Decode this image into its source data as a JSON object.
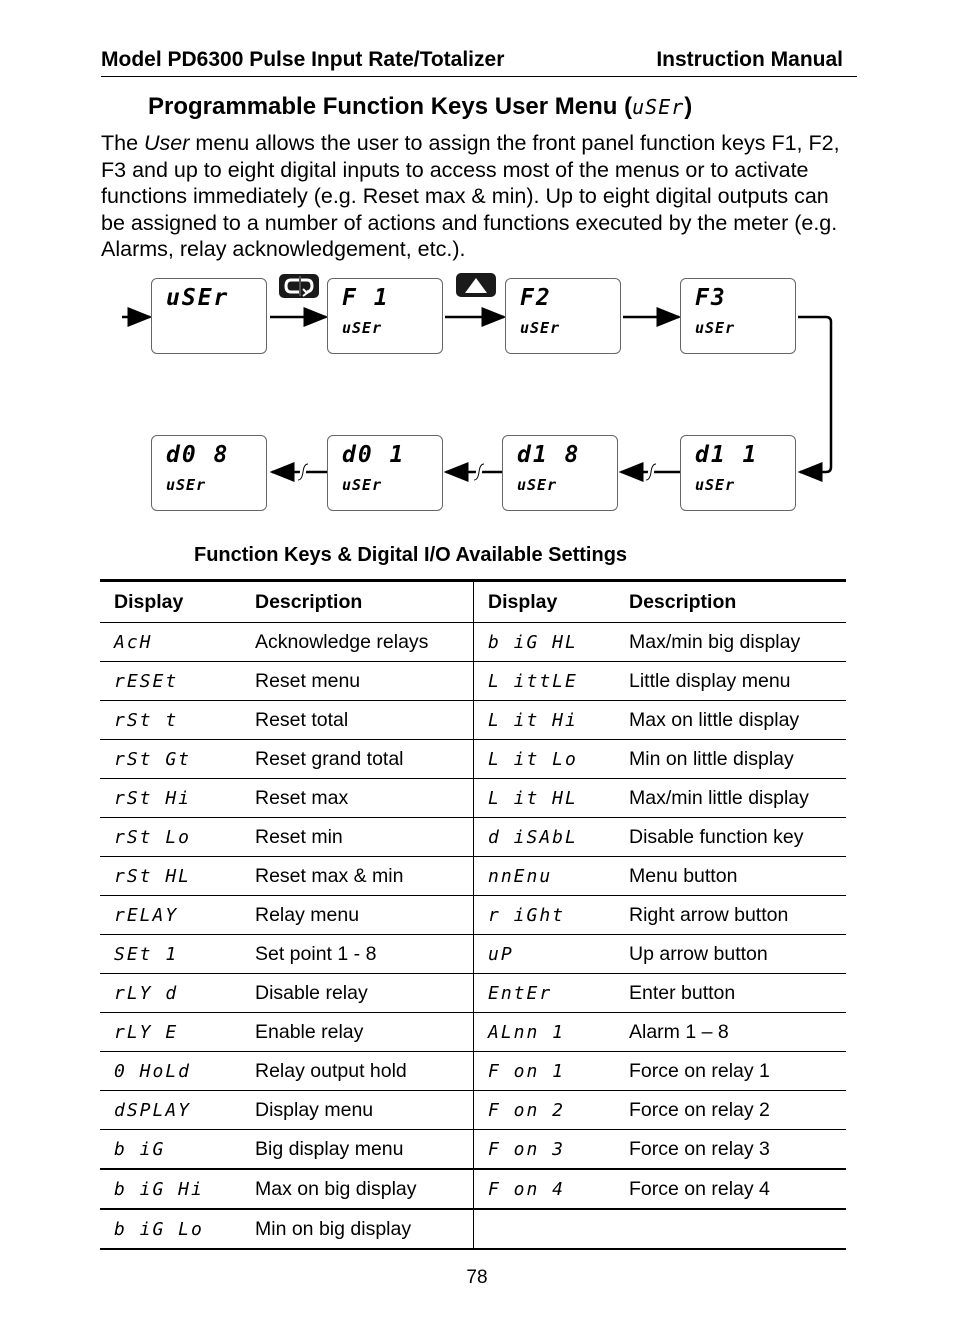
{
  "header": {
    "left": "Model PD6300 Pulse Input Rate/Totalizer",
    "right": "Instruction Manual"
  },
  "section": {
    "title_text": "Programmable Function Keys User Menu (",
    "title_code": "uSEr",
    "title_close": ")"
  },
  "intro": {
    "pre": "The ",
    "italic": "User",
    "post": " menu allows the user to assign the front panel function keys F1, F2, F3 and up to eight digital inputs to access most of the menus or to activate functions immediately (e.g. Reset max & min). Up to eight digital outputs can be assigned to a number of actions and functions executed by the meter (e.g. Alarms, relay acknowledgement, etc.)."
  },
  "diagram": {
    "keys": {
      "menu_key": "menu-key-icon",
      "up_key": "up-arrow-key-icon"
    },
    "displays": [
      {
        "top": "uSEr",
        "bottom": ""
      },
      {
        "top": "F 1",
        "bottom": "uSEr"
      },
      {
        "top": "F2",
        "bottom": "uSEr"
      },
      {
        "top": "F3",
        "bottom": "uSEr"
      },
      {
        "top": "d1 1",
        "bottom": "uSEr"
      },
      {
        "top": "d1 8",
        "bottom": "uSEr"
      },
      {
        "top": "d0 1",
        "bottom": "uSEr"
      },
      {
        "top": "d0 8",
        "bottom": "uSEr"
      }
    ]
  },
  "table": {
    "title": "Function Keys & Digital I/O Available Settings",
    "headers": [
      "Display",
      "Description",
      "Display",
      "Description"
    ],
    "rows": [
      {
        "c1": "AcH",
        "d1": "Acknowledge relays",
        "c2": "b iG HL",
        "d2": "Max/min big display"
      },
      {
        "c1": "rESEt",
        "d1": "Reset menu",
        "c2": "L ittLE",
        "d2": "Little display menu"
      },
      {
        "c1": "rSt t",
        "d1": "Reset total",
        "c2": "L it Hi",
        "d2": "Max on little display"
      },
      {
        "c1": "rSt Gt",
        "d1": "Reset grand total",
        "c2": "L it Lo",
        "d2": "Min on little display"
      },
      {
        "c1": "rSt Hi",
        "d1": "Reset max",
        "c2": "L it HL",
        "d2": "Max/min little display"
      },
      {
        "c1": "rSt Lo",
        "d1": "Reset min",
        "c2": "d iSAbL",
        "d2": "Disable function key"
      },
      {
        "c1": "rSt HL",
        "d1": "Reset max & min",
        "c2": "nnEnu",
        "d2": "Menu button"
      },
      {
        "c1": "rELAY",
        "d1": "Relay menu",
        "c2": "r iGht",
        "d2": "Right arrow button"
      },
      {
        "c1": "SEt  1",
        "d1": "Set point 1 - 8",
        "c2": "uP",
        "d2": "Up arrow button"
      },
      {
        "c1": "rLY d",
        "d1": "Disable relay",
        "c2": "EntEr",
        "d2": "Enter button"
      },
      {
        "c1": "rLY E",
        "d1": "Enable relay",
        "c2": "ALnn  1",
        "d2": "Alarm 1 – 8"
      },
      {
        "c1": "0 HoLd",
        "d1": "Relay output hold",
        "c2": "F  on  1",
        "d2": "Force on relay 1"
      },
      {
        "c1": "dSPLAY",
        "d1": "Display menu",
        "c2": "F  on  2",
        "d2": "Force on relay 2"
      },
      {
        "c1": "b iG",
        "d1": "Big display menu",
        "c2": "F  on  3",
        "d2": "Force on relay 3"
      },
      {
        "c1": "b iG Hi",
        "d1": "Max on big display",
        "c2": "F  on  4",
        "d2": "Force on relay 4"
      },
      {
        "c1": "b iG Lo",
        "d1": "Min on big display",
        "c2": "",
        "d2": ""
      }
    ]
  },
  "footer": {
    "page_number": "78"
  }
}
